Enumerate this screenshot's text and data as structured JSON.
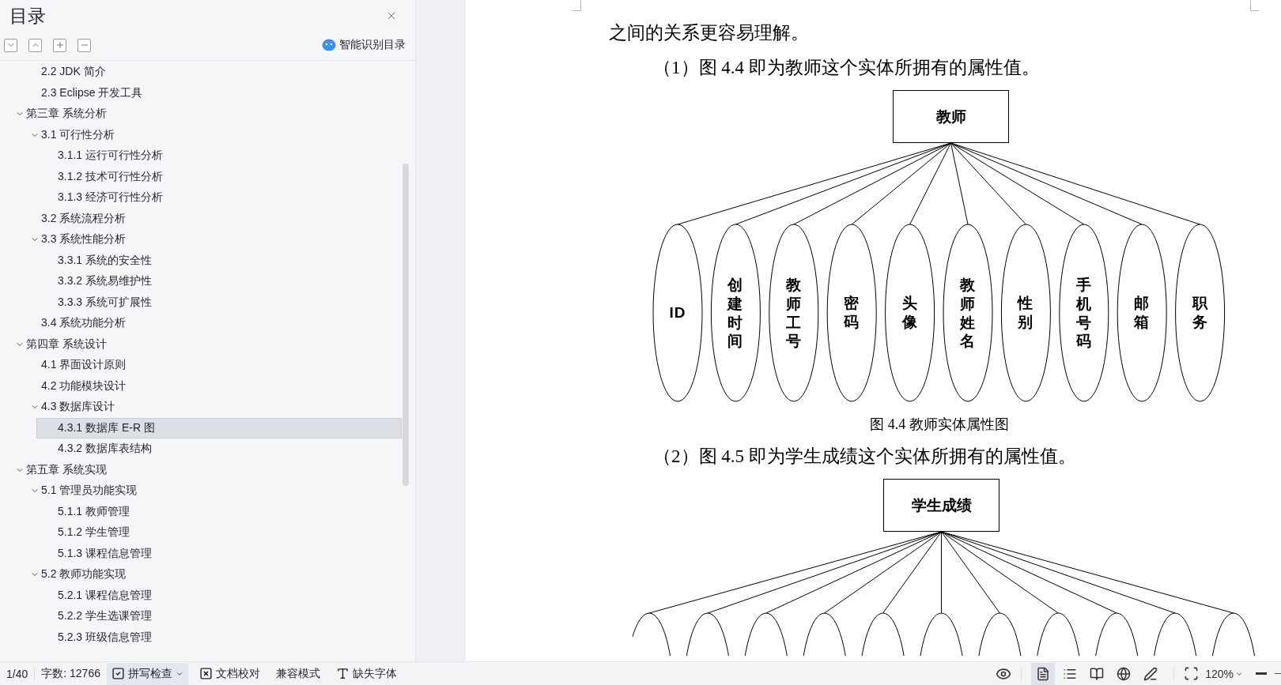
{
  "sidebar": {
    "title": "目录",
    "smart_button": "智能识别目录",
    "toc": {
      "continued_items": [
        {
          "label": "2.2 JDK 简介",
          "selected": false
        },
        {
          "label": "2.3 Eclipse 开发工具",
          "selected": false
        }
      ],
      "chapters": [
        {
          "label": "第三章  系统分析",
          "selected": false,
          "expanded": true,
          "children": [
            {
              "label": "3.1 可行性分析",
              "selected": false,
              "expanded": true,
              "children": [
                {
                  "label": "3.1.1 运行可行性分析",
                  "selected": false
                },
                {
                  "label": "3.1.2 技术可行性分析",
                  "selected": false
                },
                {
                  "label": "3.1.3 经济可行性分析",
                  "selected": false
                }
              ]
            },
            {
              "label": "3.2 系统流程分析",
              "selected": false
            },
            {
              "label": "3.3  系统性能分析",
              "selected": false,
              "expanded": true,
              "children": [
                {
                  "label": "3.3.1 系统的安全性",
                  "selected": false
                },
                {
                  "label": "3.3.2 系统易维护性",
                  "selected": false
                },
                {
                  "label": "3.3.3 系统可扩展性",
                  "selected": false
                }
              ]
            },
            {
              "label": "3.4 系统功能分析",
              "selected": false
            }
          ]
        },
        {
          "label": "第四章  系统设计",
          "selected": false,
          "expanded": true,
          "children": [
            {
              "label": "4.1 界面设计原则",
              "selected": false
            },
            {
              "label": "4.2 功能模块设计",
              "selected": false
            },
            {
              "label": "4.3 数据库设计",
              "selected": false,
              "expanded": true,
              "children": [
                {
                  "label": "4.3.1 数据库 E-R 图",
                  "selected": true
                },
                {
                  "label": "4.3.2  数据库表结构",
                  "selected": false
                }
              ]
            }
          ]
        },
        {
          "label": "第五章  系统实现",
          "selected": false,
          "expanded": true,
          "children": [
            {
              "label": "5.1  管理员功能实现",
              "selected": false,
              "expanded": true,
              "children": [
                {
                  "label": "5.1.1  教师管理",
                  "selected": false
                },
                {
                  "label": "5.1.2  学生管理",
                  "selected": false
                },
                {
                  "label": "5.1.3  课程信息管理",
                  "selected": false
                }
              ]
            },
            {
              "label": "5.2  教师功能实现",
              "selected": false,
              "expanded": true,
              "children": [
                {
                  "label": "5.2.1  课程信息管理",
                  "selected": false
                },
                {
                  "label": "5.2.2  学生选课管理",
                  "selected": false
                },
                {
                  "label": "5.2.3  班级信息管理",
                  "selected": false
                }
              ]
            }
          ]
        }
      ]
    }
  },
  "document": {
    "blocks": [
      {
        "kind": "text",
        "text": "之间的关系更容易理解。",
        "indent": false
      },
      {
        "kind": "text",
        "text": "（1）图 4.4 即为教师这个实体所拥有的属性值。",
        "indent": true
      },
      {
        "kind": "diagram",
        "entity": "教师",
        "attributes": [
          {
            "label": "ID"
          },
          {
            "label": "创建时间"
          },
          {
            "label": "教师工号"
          },
          {
            "label": "密码"
          },
          {
            "label": "头像"
          },
          {
            "label": "教师姓名"
          },
          {
            "label": "性别"
          },
          {
            "label": "手机号码"
          },
          {
            "label": "邮箱"
          },
          {
            "label": "职务"
          }
        ]
      },
      {
        "kind": "caption",
        "text": "图 4.4  教师实体属性图"
      },
      {
        "kind": "text",
        "text": "（2）图 4.5 即为学生成绩这个实体所拥有的属性值。",
        "indent": true
      },
      {
        "kind": "diagram",
        "entity": "学生成绩"
      }
    ]
  },
  "status_bar": {
    "page": "1/40",
    "word_count": "字数: 12766",
    "tools": [
      {
        "kind": "spell_check",
        "label": "拼写检查",
        "active": true,
        "has_menu": true
      },
      {
        "kind": "proofread",
        "label": "文档校对",
        "active": false,
        "has_menu": false
      },
      {
        "kind": "compat",
        "label": "兼容模式",
        "active": false,
        "has_menu": false
      },
      {
        "kind": "missing_font",
        "label": "缺失字体",
        "active": false,
        "has_menu": false
      }
    ],
    "view_modes": [
      {
        "kind": "page",
        "selected": true
      },
      {
        "kind": "outline",
        "selected": false
      },
      {
        "kind": "reading",
        "selected": false
      },
      {
        "kind": "web",
        "selected": false
      },
      {
        "kind": "writing",
        "selected": false
      }
    ],
    "zoom": "120%"
  }
}
